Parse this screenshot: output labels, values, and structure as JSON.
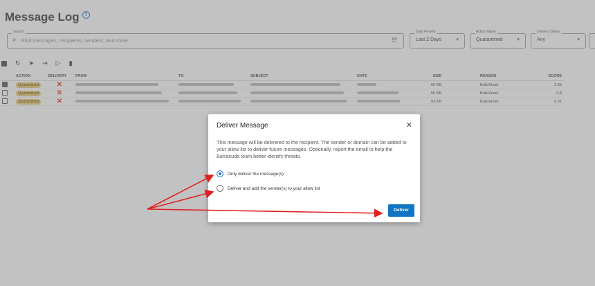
{
  "header": {
    "title": "Message Log",
    "help_icon": "?"
  },
  "search": {
    "label": "Search",
    "placeholder": "Find messages, recipients, senders, and more..."
  },
  "filters": [
    {
      "label": "Date Presets",
      "value": "Last 2 Days"
    },
    {
      "label": "Action Taken",
      "value": "Quarantined"
    },
    {
      "label": "Delivery Status",
      "value": "Any"
    }
  ],
  "table": {
    "headers": {
      "action": "ACTION",
      "delivery": "DELIVERY",
      "from": "FROM",
      "to": "TO",
      "subject": "SUBJECT",
      "date": "DATE",
      "size": "SIZE",
      "reason": "REASON",
      "score": "SCORE"
    },
    "rows": [
      {
        "checked": true,
        "action": "Quarantined",
        "size": "65 KB",
        "reason": "Bulk Email",
        "score": "2.65"
      },
      {
        "checked": false,
        "action": "Quarantined",
        "size": "55 KB",
        "reason": "Bulk Email",
        "score": "0.9"
      },
      {
        "checked": false,
        "action": "Quarantined",
        "size": "93 KB",
        "reason": "Bulk Email",
        "score": "0.21"
      }
    ]
  },
  "dialog": {
    "title": "Deliver Message",
    "close": "✕",
    "body": "This message will be delivered to the recipient. The sender or domain can be added to your allow list to deliver future messages. Optionally, report the email to help the Barracuda team better identify threats.",
    "option1": "Only deliver the message(s)",
    "option2": "Deliver and add the sender(s) to your allow list",
    "deliver_label": "Deliver"
  },
  "colors": {
    "accent": "#0f75c4",
    "arrow": "#e02020",
    "badge": "#e8c66c"
  }
}
